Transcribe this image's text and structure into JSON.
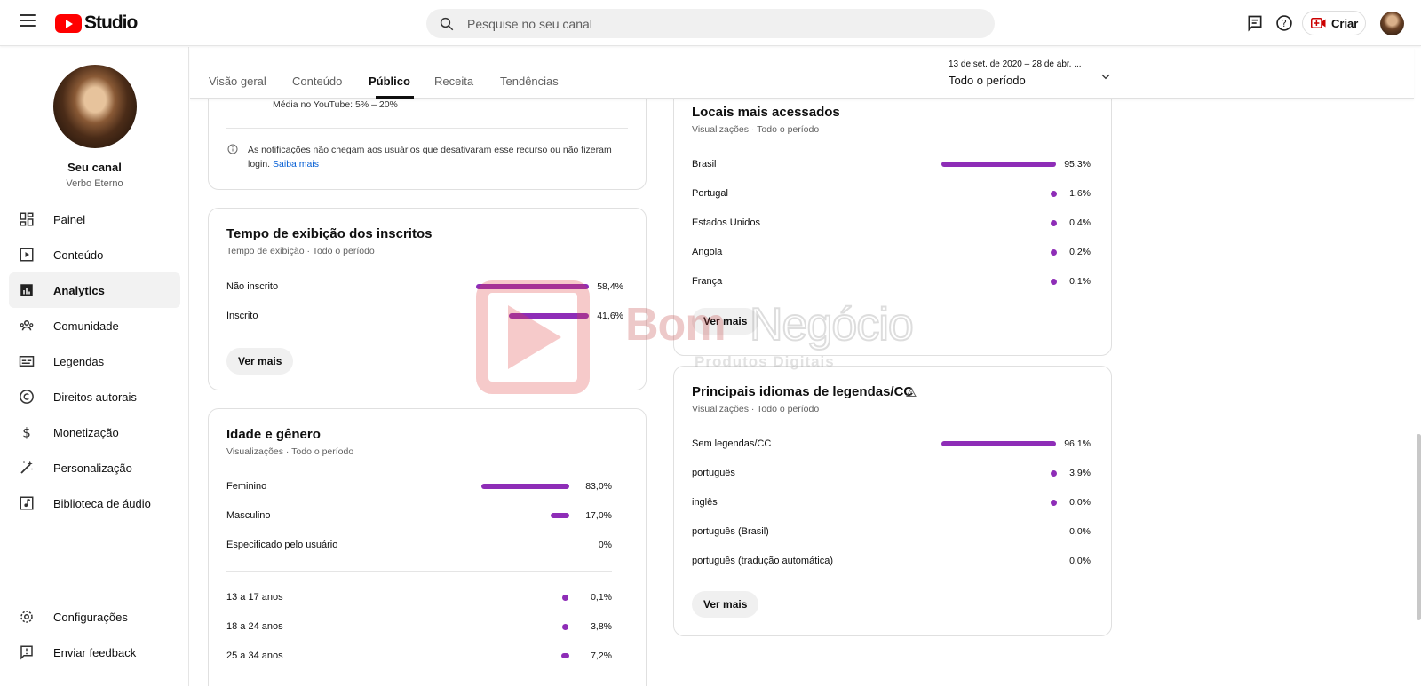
{
  "app": {
    "logo_text": "Studio",
    "search_placeholder": "Pesquise no seu canal",
    "create_label": "Criar"
  },
  "channel": {
    "name": "Seu canal",
    "handle": "Verbo Eterno"
  },
  "nav": {
    "items": [
      {
        "label": "Painel",
        "icon": "dashboard-icon"
      },
      {
        "label": "Conteúdo",
        "icon": "content-icon"
      },
      {
        "label": "Analytics",
        "icon": "analytics-icon",
        "active": true
      },
      {
        "label": "Comunidade",
        "icon": "community-icon"
      },
      {
        "label": "Legendas",
        "icon": "subtitles-icon"
      },
      {
        "label": "Direitos autorais",
        "icon": "copyright-icon"
      },
      {
        "label": "Monetização",
        "icon": "monetization-icon"
      },
      {
        "label": "Personalização",
        "icon": "customization-icon"
      },
      {
        "label": "Biblioteca de áudio",
        "icon": "audio-library-icon"
      }
    ],
    "settings": "Configurações",
    "feedback": "Enviar feedback"
  },
  "tabs": [
    "Visão geral",
    "Conteúdo",
    "Público",
    "Receita",
    "Tendências"
  ],
  "active_tab": "Público",
  "date_range": {
    "dates": "13 de set. de 2020 – 28 de abr. ...",
    "label": "Todo o período"
  },
  "notif_card": {
    "youtube_avg": "Média no YouTube: 5% – 20%",
    "note": "As notificações não chegam aos usuários que desativaram esse recurso ou não fizeram login.",
    "link": "Saiba mais"
  },
  "watch_time": {
    "title": "Tempo de exibição dos inscritos",
    "subtitle": "Tempo de exibição · Todo o período",
    "rows": [
      {
        "label": "Não inscrito",
        "value": "58,4%",
        "percent": 58.4
      },
      {
        "label": "Inscrito",
        "value": "41,6%",
        "percent": 41.6
      }
    ],
    "more": "Ver mais"
  },
  "age_gender": {
    "title": "Idade e gênero",
    "subtitle": "Visualizações · Todo o período",
    "gender": [
      {
        "label": "Feminino",
        "value": "83,0%",
        "percent": 83.0
      },
      {
        "label": "Masculino",
        "value": "17,0%",
        "percent": 17.0
      },
      {
        "label": "Especificado pelo usuário",
        "value": "0%",
        "percent": 0
      }
    ],
    "ages": [
      {
        "label": "13 a 17 anos",
        "value": "0,1%",
        "percent": 0.1
      },
      {
        "label": "18 a 24 anos",
        "value": "3,8%",
        "percent": 3.8
      },
      {
        "label": "25 a 34 anos",
        "value": "7,2%",
        "percent": 7.2
      }
    ]
  },
  "locations": {
    "title": "Locais mais acessados",
    "subtitle": "Visualizações · Todo o período",
    "rows": [
      {
        "label": "Brasil",
        "value": "95,3%",
        "percent": 95.3
      },
      {
        "label": "Portugal",
        "value": "1,6%",
        "percent": 1.6
      },
      {
        "label": "Estados Unidos",
        "value": "0,4%",
        "percent": 0.4
      },
      {
        "label": "Angola",
        "value": "0,2%",
        "percent": 0.2
      },
      {
        "label": "França",
        "value": "0,1%",
        "percent": 0.1
      }
    ],
    "more": "Ver mais"
  },
  "languages": {
    "title": "Principais idiomas de legendas/CC",
    "subtitle": "Visualizações · Todo o período",
    "rows": [
      {
        "label": "Sem legendas/CC",
        "value": "96,1%",
        "percent": 96.1
      },
      {
        "label": "português",
        "value": "3,9%",
        "percent": 3.9
      },
      {
        "label": "inglês",
        "value": "0,0%",
        "percent": 0.04
      },
      {
        "label": "português (Brasil)",
        "value": "0,0%",
        "percent": 0
      },
      {
        "label": "português (tradução automática)",
        "value": "0,0%",
        "percent": 0
      }
    ],
    "more": "Ver mais"
  },
  "watermark": {
    "brand_bold": "Bom",
    "brand_outline": "Negócio",
    "tagline": "Produtos Digitais"
  },
  "colors": {
    "accent": "#8e2db7",
    "brand_red": "#ff0000"
  }
}
